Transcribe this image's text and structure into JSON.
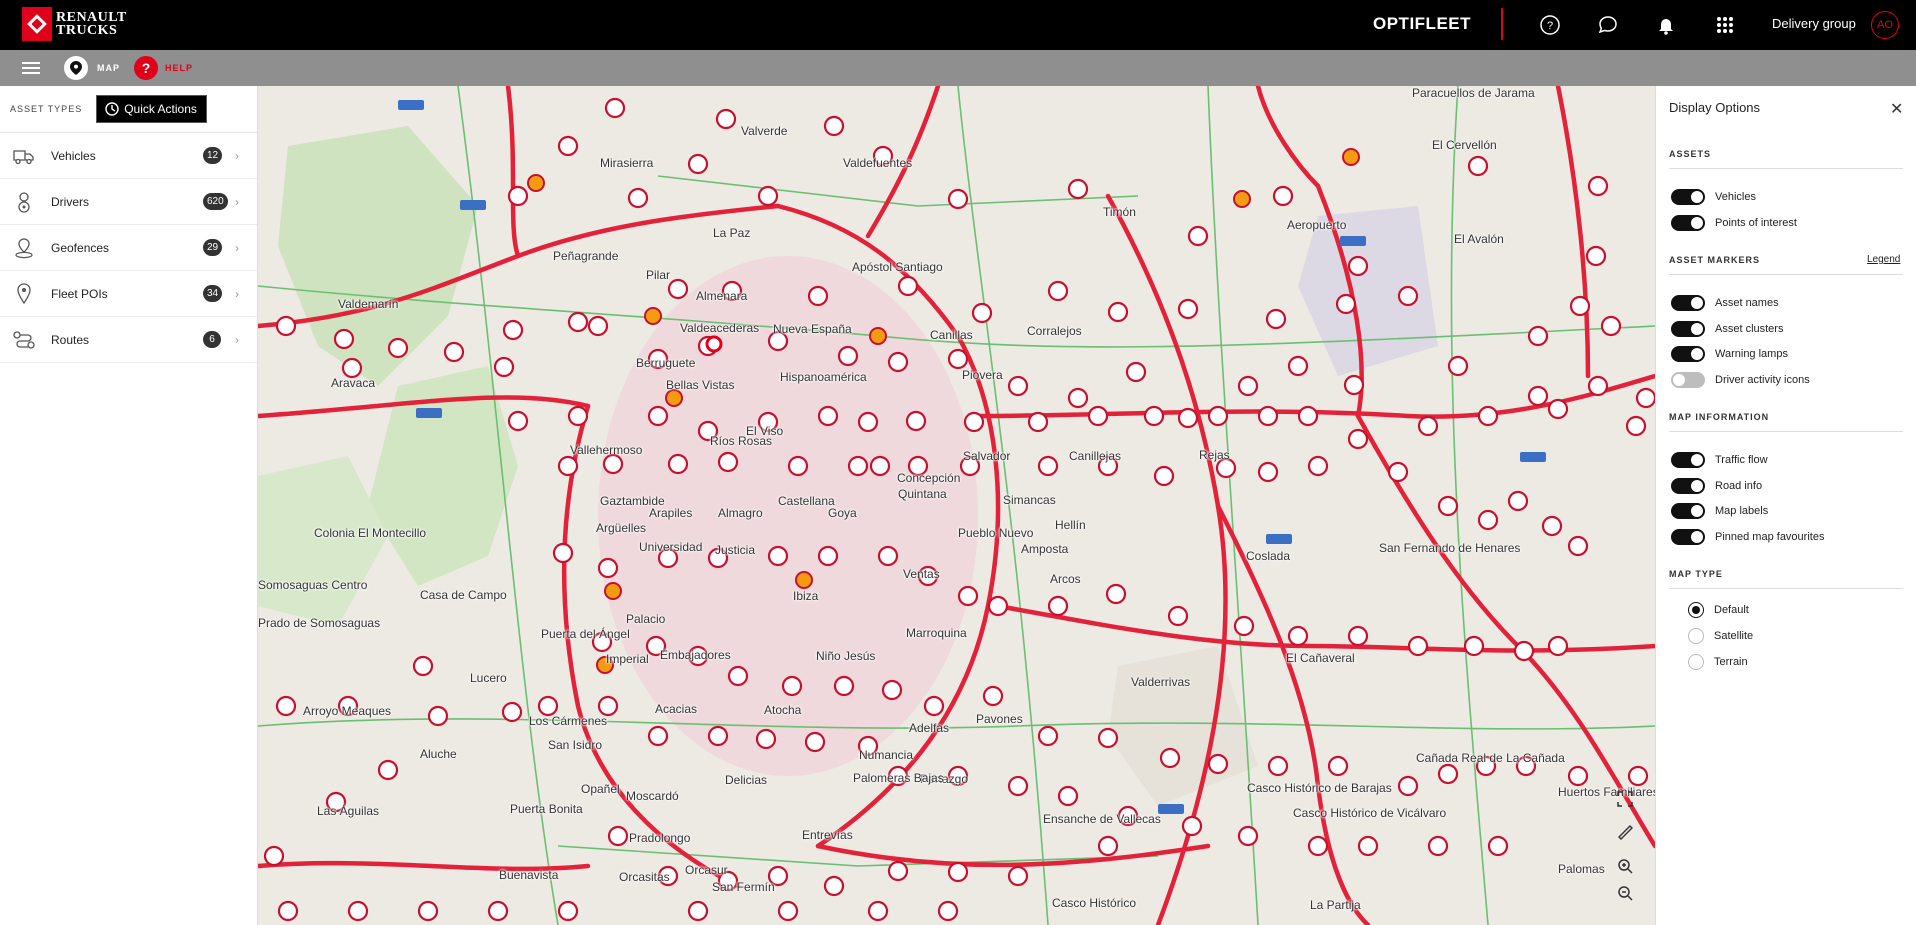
{
  "header": {
    "brand_line1": "RENAULT",
    "brand_line2": "TRUCKS",
    "app_title": "OPTIFLEET",
    "group": "Delivery group",
    "avatar_initials": "AO",
    "icons": [
      "help-icon",
      "chat-icon",
      "bell-icon",
      "apps-grid-icon"
    ]
  },
  "subbar": {
    "map_label": "MAP",
    "help_label": "HELP"
  },
  "left_panel": {
    "section_label": "ASSET TYPES",
    "quick_actions": "Quick Actions",
    "items": [
      {
        "name": "Vehicles",
        "count": "12",
        "icon": "truck-icon"
      },
      {
        "name": "Drivers",
        "count": "620",
        "icon": "driver-icon"
      },
      {
        "name": "Geofences",
        "count": "29",
        "icon": "geofence-icon"
      },
      {
        "name": "Fleet POIs",
        "count": "34",
        "icon": "pin-icon"
      },
      {
        "name": "Routes",
        "count": "6",
        "icon": "route-icon"
      }
    ]
  },
  "map": {
    "labels": [
      {
        "text": "Paracuellos de Jarama"
      },
      {
        "text": "El Cervellón"
      },
      {
        "text": "Valverde"
      },
      {
        "text": "Mirasierra"
      },
      {
        "text": "Valdefuentes"
      },
      {
        "text": "Aeropuerto"
      },
      {
        "text": "El Avalón"
      },
      {
        "text": "Timón"
      },
      {
        "text": "La Paz"
      },
      {
        "text": "Peñagrande"
      },
      {
        "text": "Apóstol Santiago"
      },
      {
        "text": "Pilar"
      },
      {
        "text": "Almenara"
      },
      {
        "text": "Valdemarín"
      },
      {
        "text": "Valdeacederas"
      },
      {
        "text": "Nueva España"
      },
      {
        "text": "Canillas"
      },
      {
        "text": "Corralejos"
      },
      {
        "text": "Aravaca"
      },
      {
        "text": "Berruguete"
      },
      {
        "text": "Hispanoamérica"
      },
      {
        "text": "Piovera"
      },
      {
        "text": "Bellas Vistas"
      },
      {
        "text": "El Viso"
      },
      {
        "text": "Ríos Rosas"
      },
      {
        "text": "Vallehermoso"
      },
      {
        "text": "Salvador"
      },
      {
        "text": "Canillejas"
      },
      {
        "text": "Rejas"
      },
      {
        "text": "Concepción"
      },
      {
        "text": "Quintana"
      },
      {
        "text": "Simancas"
      },
      {
        "text": "Gaztambide"
      },
      {
        "text": "Castellana"
      },
      {
        "text": "Arapiles"
      },
      {
        "text": "Almagro"
      },
      {
        "text": "Goya"
      },
      {
        "text": "Argüelles"
      },
      {
        "text": "Hellín"
      },
      {
        "text": "Coslada"
      },
      {
        "text": "San Fernando de Henares"
      },
      {
        "text": "Colonia El Montecillo"
      },
      {
        "text": "Universidad"
      },
      {
        "text": "Justicia"
      },
      {
        "text": "Pueblo Nuevo"
      },
      {
        "text": "Amposta"
      },
      {
        "text": "Ventas"
      },
      {
        "text": "Arcos"
      },
      {
        "text": "Somosaguas Centro"
      },
      {
        "text": "Casa de Campo"
      },
      {
        "text": "Palacio"
      },
      {
        "text": "Ibiza"
      },
      {
        "text": "Marroquina"
      },
      {
        "text": "Prado de Somosaguas"
      },
      {
        "text": "Puerta del Ángel"
      },
      {
        "text": "Imperial"
      },
      {
        "text": "Embajadores"
      },
      {
        "text": "Niño Jesús"
      },
      {
        "text": "Valderrivas"
      },
      {
        "text": "El Cañaveral"
      },
      {
        "text": "Lucero"
      },
      {
        "text": "Los Cármenes"
      },
      {
        "text": "Acacias"
      },
      {
        "text": "Atocha"
      },
      {
        "text": "Adelfas"
      },
      {
        "text": "Pavones"
      },
      {
        "text": "Arroyo Meaques"
      },
      {
        "text": "Aluche"
      },
      {
        "text": "San Isidro"
      },
      {
        "text": "Numancia"
      },
      {
        "text": "Portazgo"
      },
      {
        "text": "Palomeras Bajas"
      },
      {
        "text": "Delicias"
      },
      {
        "text": "Opañel"
      },
      {
        "text": "Moscardó"
      },
      {
        "text": "Casco Histórico de Vicálvaro"
      },
      {
        "text": "Cañada Real de La Cañada"
      },
      {
        "text": "Huertos Familiares"
      },
      {
        "text": "Las Águilas"
      },
      {
        "text": "Puerta Bonita"
      },
      {
        "text": "Pradolongo"
      },
      {
        "text": "Entrevías"
      },
      {
        "text": "Ensanche de Vallecas"
      },
      {
        "text": "Buenavista"
      },
      {
        "text": "Orcasitas"
      },
      {
        "text": "Orcasur"
      },
      {
        "text": "San Fermín"
      },
      {
        "text": "Casco Histórico"
      },
      {
        "text": "La Partija"
      },
      {
        "text": "Casco Histórico de Barajas"
      },
      {
        "text": "Palomas"
      }
    ],
    "controls": [
      "fullscreen-icon",
      "measure-icon",
      "zoom-in-icon",
      "zoom-out-icon"
    ]
  },
  "right_panel": {
    "title": "Display Options",
    "sections": {
      "assets": "ASSETS",
      "asset_markers": "ASSET MARKERS",
      "legend": "Legend",
      "map_information": "MAP INFORMATION",
      "map_type": "MAP TYPE"
    },
    "assets": [
      {
        "label": "Vehicles",
        "on": true
      },
      {
        "label": "Points of interest",
        "on": true
      }
    ],
    "asset_markers": [
      {
        "label": "Asset names",
        "on": true
      },
      {
        "label": "Asset clusters",
        "on": true
      },
      {
        "label": "Warning lamps",
        "on": true
      },
      {
        "label": "Driver activity icons",
        "on": false
      }
    ],
    "map_information": [
      {
        "label": "Traffic flow",
        "on": true
      },
      {
        "label": "Road info",
        "on": true
      },
      {
        "label": "Map labels",
        "on": true
      },
      {
        "label": "Pinned map favourites",
        "on": true
      }
    ],
    "map_type": [
      {
        "label": "Default",
        "selected": true
      },
      {
        "label": "Satellite",
        "selected": false
      },
      {
        "label": "Terrain",
        "selected": false
      }
    ]
  }
}
